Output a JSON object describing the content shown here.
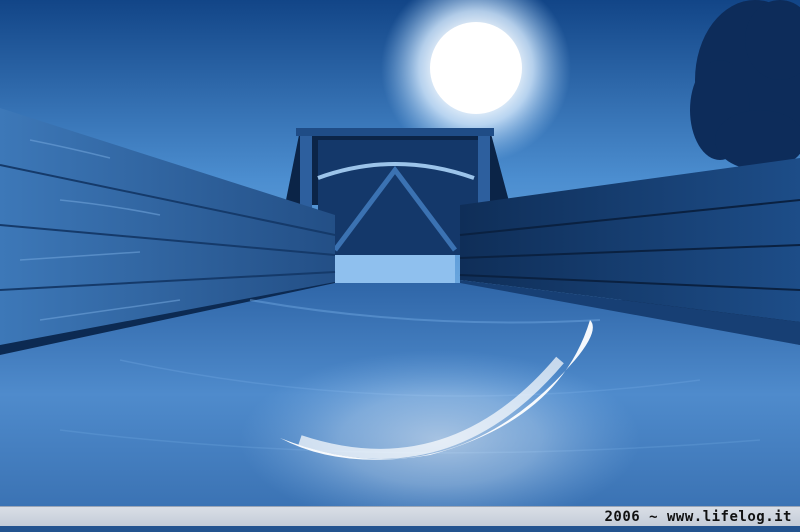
{
  "photo": {
    "subject": "playground-slide",
    "tint": "#2d5fa0"
  },
  "caption": {
    "text": "2006 ~ www.lifelog.it"
  },
  "colors": {
    "sky_top": "#0e3a78",
    "sky_mid": "#3f7fc4",
    "sun": "#ffffff",
    "wood": "#1d4d88",
    "wood_dark": "#0b2447",
    "slide_metal": "#4d86c6",
    "caption_bg": "#d3d9e2"
  }
}
